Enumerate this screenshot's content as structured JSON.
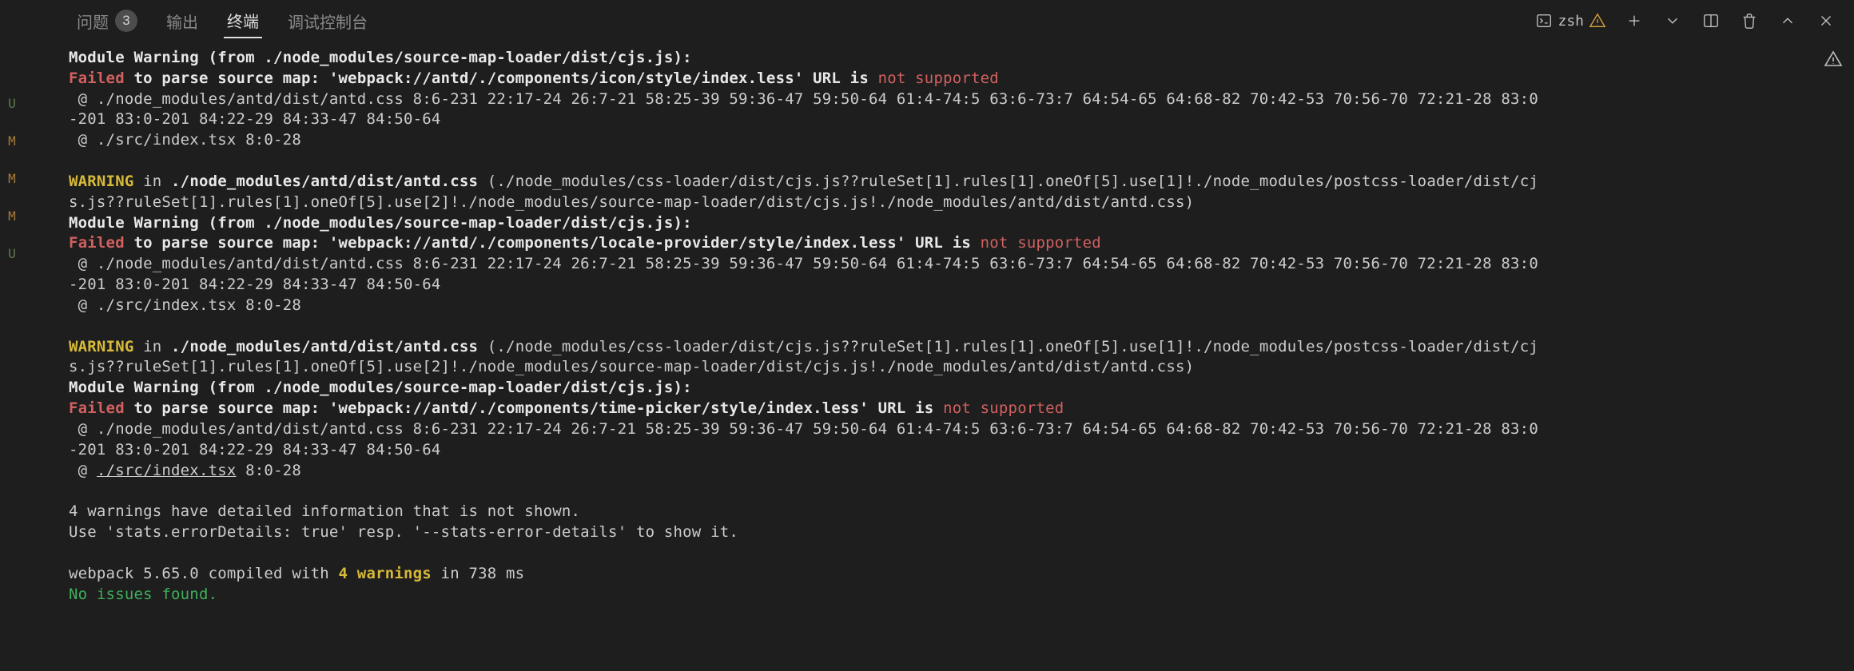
{
  "gutter": {
    "markers": [
      "U",
      "M",
      "M",
      "M",
      "U"
    ]
  },
  "tabs": {
    "problems": {
      "label": "问题",
      "count": "3"
    },
    "output": {
      "label": "输出"
    },
    "terminal": {
      "label": "终端",
      "active": true
    },
    "debug": {
      "label": "调试控制台"
    }
  },
  "toolbar": {
    "shell": "zsh"
  },
  "log": {
    "l01": "Module Warning (from ./node_modules/source-map-loader/dist/cjs.js):",
    "l02_failed": "Failed",
    "l02_mid": " to parse source map: 'webpack://antd/./components/icon/style/index.less' URL is ",
    "l02_not": "not supported",
    "l03": " @ ./node_modules/antd/dist/antd.css 8:6-231 22:17-24 26:7-21 58:25-39 59:36-47 59:50-64 61:4-74:5 63:6-73:7 64:54-65 64:68-82 70:42-53 70:56-70 72:21-28 83:0",
    "l04": "-201 83:0-201 84:22-29 84:33-47 84:50-64",
    "l05": " @ ./src/index.tsx 8:0-28",
    "l07_warn": "WARNING",
    "l07_in": " in ",
    "l07_path": "./node_modules/antd/dist/antd.css",
    "l07_rest": " (./node_modules/css-loader/dist/cjs.js??ruleSet[1].rules[1].oneOf[5].use[1]!./node_modules/postcss-loader/dist/cj",
    "l08": "s.js??ruleSet[1].rules[1].oneOf[5].use[2]!./node_modules/source-map-loader/dist/cjs.js!./node_modules/antd/dist/antd.css)",
    "l09": "Module Warning (from ./node_modules/source-map-loader/dist/cjs.js):",
    "l10_failed": "Failed",
    "l10_mid": " to parse source map: 'webpack://antd/./components/locale-provider/style/index.less' URL is ",
    "l10_not": "not supported",
    "l11": " @ ./node_modules/antd/dist/antd.css 8:6-231 22:17-24 26:7-21 58:25-39 59:36-47 59:50-64 61:4-74:5 63:6-73:7 64:54-65 64:68-82 70:42-53 70:56-70 72:21-28 83:0",
    "l12": "-201 83:0-201 84:22-29 84:33-47 84:50-64",
    "l13": " @ ./src/index.tsx 8:0-28",
    "l15_warn": "WARNING",
    "l15_in": " in ",
    "l15_path": "./node_modules/antd/dist/antd.css",
    "l15_rest": " (./node_modules/css-loader/dist/cjs.js??ruleSet[1].rules[1].oneOf[5].use[1]!./node_modules/postcss-loader/dist/cj",
    "l16": "s.js??ruleSet[1].rules[1].oneOf[5].use[2]!./node_modules/source-map-loader/dist/cjs.js!./node_modules/antd/dist/antd.css)",
    "l17": "Module Warning (from ./node_modules/source-map-loader/dist/cjs.js):",
    "l18_failed": "Failed",
    "l18_mid": " to parse source map: 'webpack://antd/./components/time-picker/style/index.less' URL is ",
    "l18_not": "not supported",
    "l19": " @ ./node_modules/antd/dist/antd.css 8:6-231 22:17-24 26:7-21 58:25-39 59:36-47 59:50-64 61:4-74:5 63:6-73:7 64:54-65 64:68-82 70:42-53 70:56-70 72:21-28 83:0",
    "l20": "-201 83:0-201 84:22-29 84:33-47 84:50-64",
    "l21_a": " @ ",
    "l21_b": "./src/index.tsx",
    "l21_c": " 8:0-28",
    "l23": "4 warnings have detailed information that is not shown.",
    "l24": "Use 'stats.errorDetails: true' resp. '--stats-error-details' to show it.",
    "l26_a": "webpack 5.65.0 compiled with ",
    "l26_b": "4 warnings",
    "l26_c": " in 738 ms",
    "l27": "No issues found."
  }
}
